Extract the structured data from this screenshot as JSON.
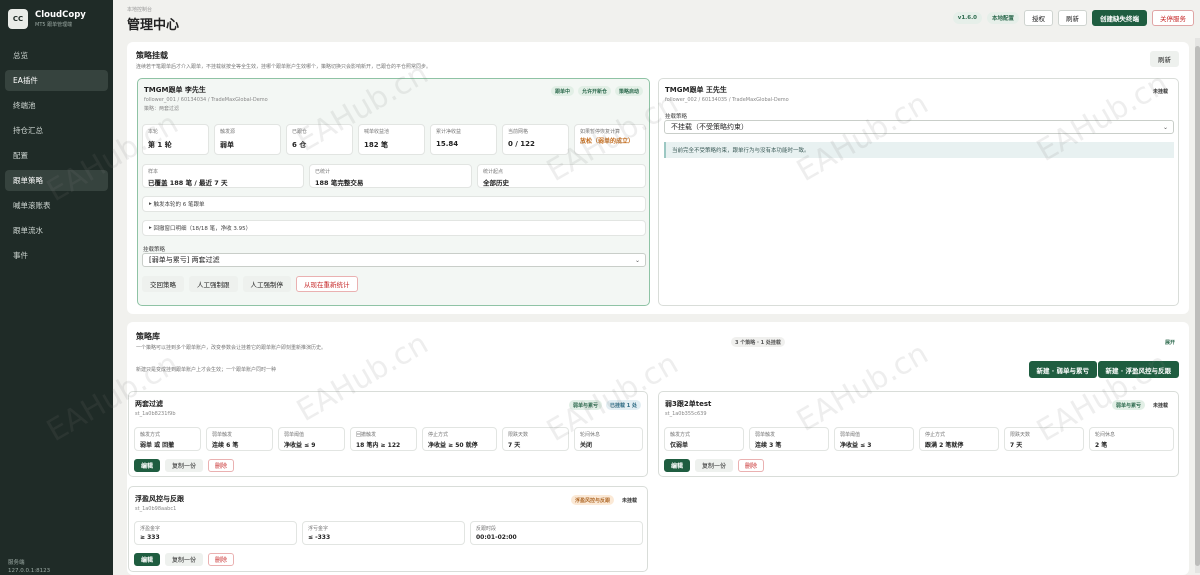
{
  "brand": {
    "logo": "CC",
    "name": "CloudCopy",
    "sub": "MT5 跟单管理端"
  },
  "nav": [
    {
      "label": "总览"
    },
    {
      "label": "EA插件"
    },
    {
      "label": "终端池"
    },
    {
      "label": "持仓汇总"
    },
    {
      "label": "配置"
    },
    {
      "label": "跟单策略"
    },
    {
      "label": "喊单滚账表"
    },
    {
      "label": "跟单流水"
    },
    {
      "label": "事件"
    }
  ],
  "sidebar_footer": [
    "服务端",
    "127.0.0.1:8123"
  ],
  "header": {
    "crumb": "本地控制台",
    "title": "管理中心",
    "version": "v1.6.0",
    "mode": "本地配置",
    "auth": "授权",
    "refresh": "刷新",
    "create": "创建缺失终端",
    "stop": "关停服务"
  },
  "attach": {
    "title": "策略挂载",
    "sub": "连续若干笔跟单后才介入跟单，不挂载就按全等全生效，挂哪个跟单账户生效哪个，策略切换只会影响新开，已跟仓的平仓照常同步。",
    "refresh": "刷新",
    "acct1": {
      "name": "TMGM跟单 李先生",
      "id": "follower_001 / 60134034 / TradeMaxGlobal-Demo",
      "mode": "策略：两套过滤",
      "chips": [
        "跟单中",
        "允许开新仓",
        "策略启动"
      ],
      "stats": [
        {
          "k": "本轮",
          "v": "第 1 轮"
        },
        {
          "k": "触发源",
          "v": "弱单"
        },
        {
          "k": "已跟仓",
          "v": "6 仓"
        },
        {
          "k": "喊单收益池",
          "v": "182 笔"
        },
        {
          "k": "累计净收益",
          "v": "15.84"
        },
        {
          "k": "当前网格",
          "v": "0 / 122"
        },
        {
          "k": "如果暂停恢复计算",
          "v": "放松（弱单的成立）"
        }
      ],
      "sample": [
        {
          "k": "样本",
          "v": "已覆盖 188 笔 / 最近 7 天"
        },
        {
          "k": "已统计",
          "v": "188 笔完整交易"
        },
        {
          "k": "统计起点",
          "v": "全部历史"
        }
      ],
      "row1": "触发本轮的 6 笔跟单",
      "row2": "回撤窗口明细（18/18 笔，净收 3.95）",
      "strategy_label": "挂载策略",
      "strategy_value": "[弱单与累亏] 两套过滤",
      "buttons": [
        "交回策略",
        "人工强制跟",
        "人工强制停",
        "从现在重新统计"
      ]
    },
    "acct2": {
      "name": "TMGM跟单 王先生",
      "id": "follower_002 / 60134035 / TradeMaxGlobal-Demo",
      "status": "未挂载",
      "strategy_label": "挂载策略",
      "strategy_value": "不挂载（不受策略约束）",
      "info": "当前完全不受策略约束，跟单行为与没有本功能时一致。"
    }
  },
  "library": {
    "title": "策略库",
    "sub": "一个策略可以挂到多个跟单账户，改变参数会让挂着它的跟单账户即刻重新推演历史。",
    "count": "3 个策略 · 1 处挂载",
    "expand": "展开",
    "note": "新建只是变成挂到跟单账户上才会生效；一个跟单账户同时一种",
    "new1": "新建 · 弱单与累亏",
    "new2": "新建 · 浮盈风控与反跟",
    "s1": {
      "name": "两套过滤",
      "id": "st_1a0b8231f9b",
      "chips": [
        "弱单与累亏",
        "已挂载 1 处"
      ],
      "stats": [
        {
          "k": "触发方式",
          "v": "弱单 或 回撤"
        },
        {
          "k": "弱单触发",
          "v": "连续 6 笔"
        },
        {
          "k": "弱单阈值",
          "v": "净收益 ≤ 9"
        },
        {
          "k": "回撤触发",
          "v": "18 笔内 ≥ 122"
        },
        {
          "k": "停止方式",
          "v": "净收益 ≥ 50 就停"
        },
        {
          "k": "限跌天数",
          "v": "7 天"
        },
        {
          "k": "轮间休息",
          "v": "关闭"
        }
      ],
      "buttons": [
        "编辑",
        "复制一份",
        "删除"
      ]
    },
    "s2": {
      "name": "弱3跟2单test",
      "id": "st_1a0b355c639",
      "chips": [
        "弱单与累亏",
        "未挂载"
      ],
      "stats": [
        {
          "k": "触发方式",
          "v": "仅弱单"
        },
        {
          "k": "弱单触发",
          "v": "连续 3 笔"
        },
        {
          "k": "弱单阈值",
          "v": "净收益 ≤ 3"
        },
        {
          "k": "停止方式",
          "v": "跟满 2 笔就停"
        },
        {
          "k": "限跌天数",
          "v": "7 天"
        },
        {
          "k": "轮间休息",
          "v": "2 笔"
        }
      ],
      "buttons": [
        "编辑",
        "复制一份",
        "删除"
      ]
    },
    "s3": {
      "name": "浮盈风控与反跟",
      "id": "st_1a0b98aabc1",
      "chips": [
        "浮盈风控与反跟",
        "未挂载"
      ],
      "stats": [
        {
          "k": "浮盈金字",
          "v": "≥ 333"
        },
        {
          "k": "浮亏金字",
          "v": "≤ -333"
        },
        {
          "k": "反跟时段",
          "v": "00:01-02:00"
        }
      ],
      "buttons": [
        "编辑",
        "复制一份",
        "删除"
      ]
    }
  },
  "watermark": "EAHub.cn"
}
